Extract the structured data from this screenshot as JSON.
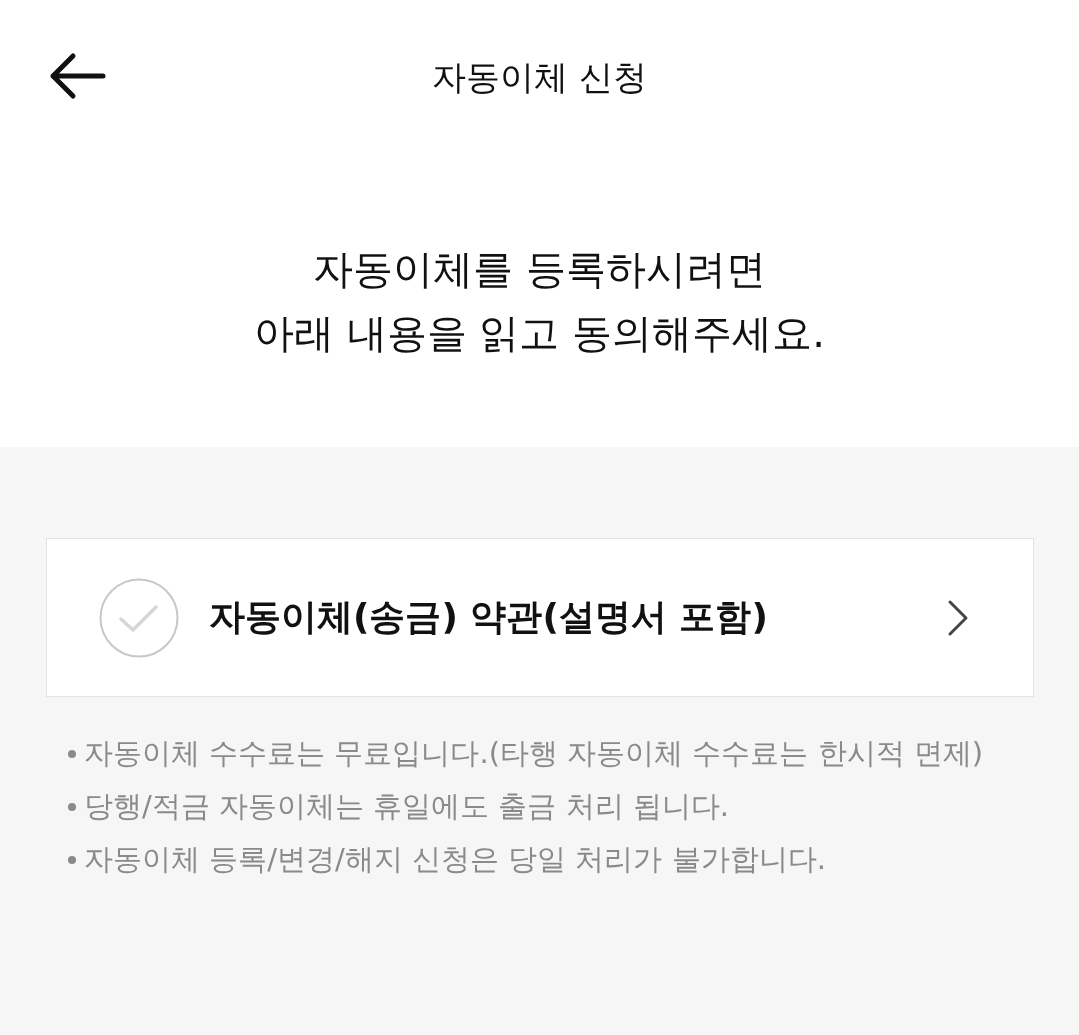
{
  "header": {
    "title": "자동이체 신청"
  },
  "intro": {
    "lines": [
      "자동이체를 등록하시려면",
      "아래 내용을 읽고 동의해주세요."
    ]
  },
  "agreement": {
    "label": "자동이체(송금) 약관(설명서 포함)",
    "checked": false
  },
  "notes": [
    "자동이체 수수료는 무료입니다.(타행 자동이체 수수료는 한시적 면제)",
    "당행/적금 자동이체는 휴일에도 출금 처리 됩니다.",
    "자동이체 등록/변경/해지 신청은 당일 처리가 불가합니다."
  ]
}
